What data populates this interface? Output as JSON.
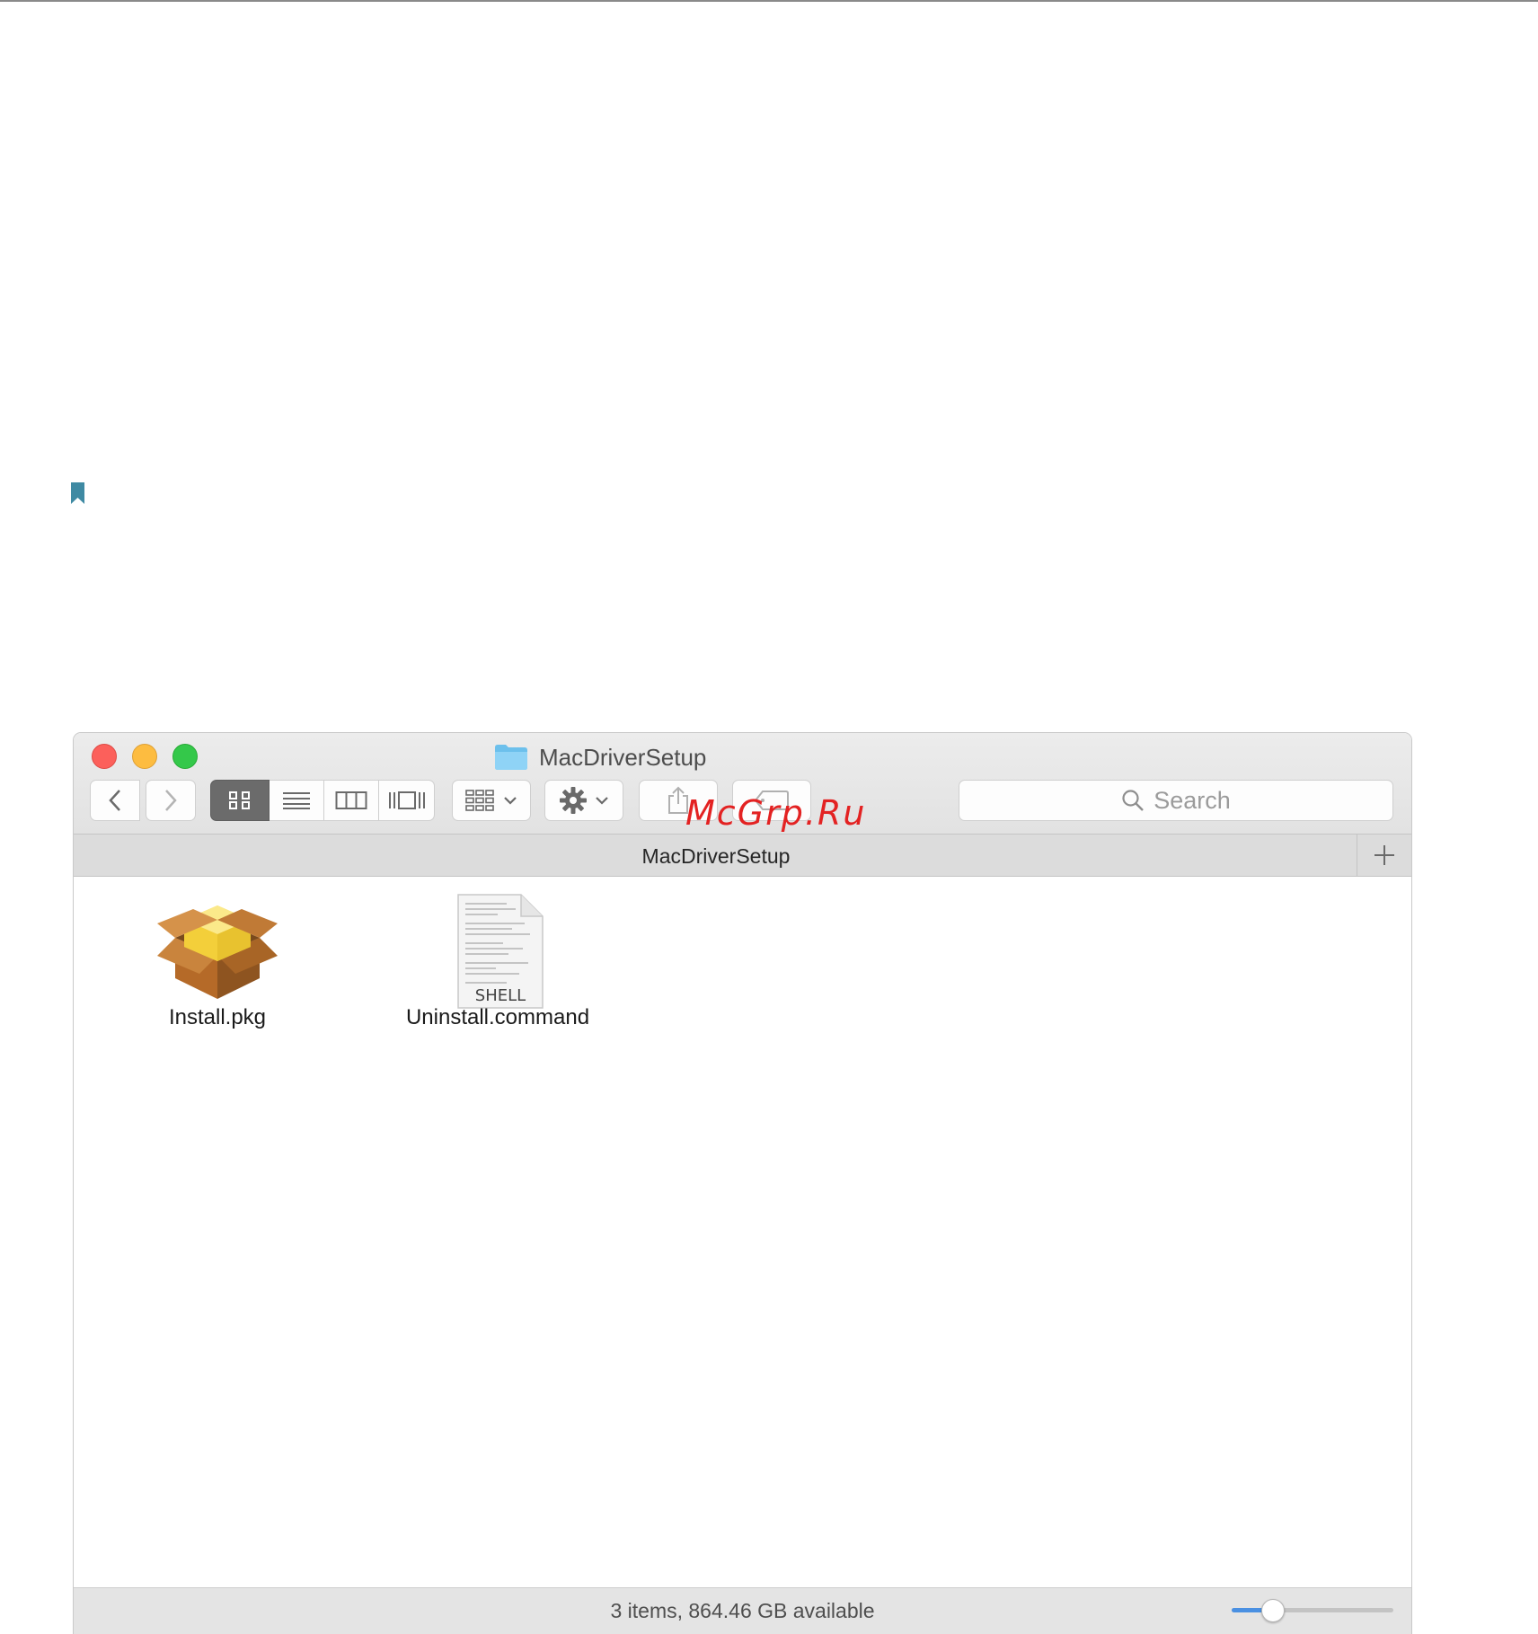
{
  "window": {
    "title": "MacDriverSetup",
    "path_label": "MacDriverSetup"
  },
  "toolbar": {
    "search_placeholder": "Search",
    "view_modes": [
      "icon-view",
      "list-view",
      "column-view",
      "cover-flow-view"
    ],
    "active_view": "icon-view"
  },
  "files": [
    {
      "name": "Install.pkg",
      "icon": "package-icon"
    },
    {
      "name": "Uninstall.command",
      "icon": "shell-script-icon",
      "badge": "SHELL"
    }
  ],
  "status": {
    "text": "3 items, 864.46 GB available",
    "icon_size_fraction": 0.25
  },
  "colors": {
    "close": "#fc605b",
    "minimize": "#fdbc40",
    "maximize": "#34c84a",
    "accent": "#4a90e2",
    "watermark": "#e32222",
    "bookmark": "#3f8aa3"
  },
  "watermark": "McGrp.Ru"
}
